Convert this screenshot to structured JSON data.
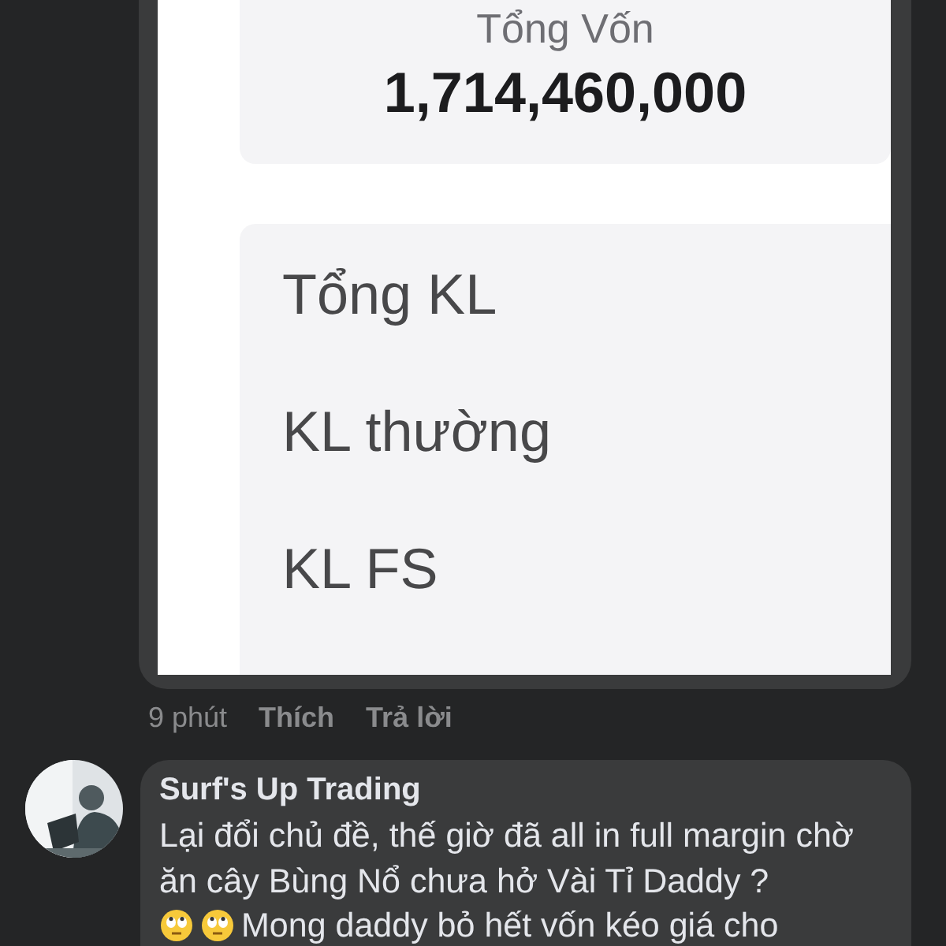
{
  "shared_screenshot": {
    "summary_card": {
      "label": "Tổng Vốn",
      "value": "1,714,460,000"
    },
    "volume_rows": [
      {
        "label": "Tổng KL"
      },
      {
        "label": "KL thường"
      },
      {
        "label": "KL FS"
      }
    ]
  },
  "comment_actions": {
    "time": "9 phút",
    "like": "Thích",
    "reply": "Trả lời"
  },
  "reply": {
    "author": "Surf's Up Trading",
    "text": "Lại đổi chủ đề, thế giờ đã all in full margin chờ ăn cây Bùng Nổ chưa hở  Vài Tỉ Daddy ?",
    "continuation": "Mong daddy bỏ hết vốn kéo giá cho"
  }
}
